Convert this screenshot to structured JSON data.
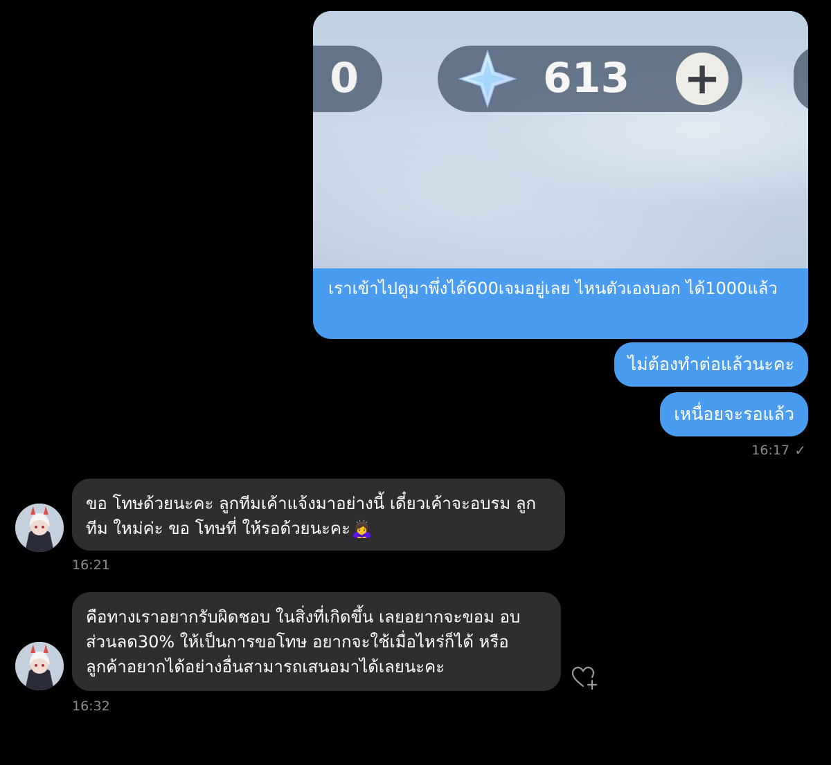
{
  "messages": {
    "sent_image": {
      "left_counter_partial": "0",
      "currency_value": "613",
      "plus_symbol": "+",
      "caption": "เราเข้าไปดูมาพึ่งได้600เจมอยู่เลย ไหนตัวเองบอก ได้1000แล้ว"
    },
    "sent_2": "ไม่ต้องทำต่อแล้วนะคะ",
    "sent_3": "เหนื่อยจะรอแล้ว",
    "sent_time": "16:17",
    "received_1": {
      "text": "ขอ โทษด้วยนะคะ ลูกทีมเค้าแจ้งมาอย่างนี้ เดี๋ยวเค้าจะอบรม ลูกทีม ใหม่ค่ะ ขอ โทษที่ ให้รอด้วยนะคะ",
      "emoji": "🙇‍♀️",
      "time": "16:21"
    },
    "received_2": {
      "text": "คือทางเราอยากรับผิดชอบ ในสิ่งที่เกิดขึ้น เลยอยากจะขอม อบส่วนลด30% ให้เป็นการขอโทษ อยากจะใช้เมื่อไหร่ก็ได้ หรือ ลูกค้าอยากได้อย่างอื่นสามารถเสนอมาได้เลยนะคะ",
      "time": "16:32"
    }
  },
  "colors": {
    "sent_bubble": "#4a9cf0",
    "received_bubble": "#2e2e30",
    "background": "#000000",
    "timestamp": "#8c8c8c"
  },
  "icons": {
    "read_receipt": "check-icon",
    "reaction": "heart-plus-icon",
    "currency": "gem-icon"
  }
}
